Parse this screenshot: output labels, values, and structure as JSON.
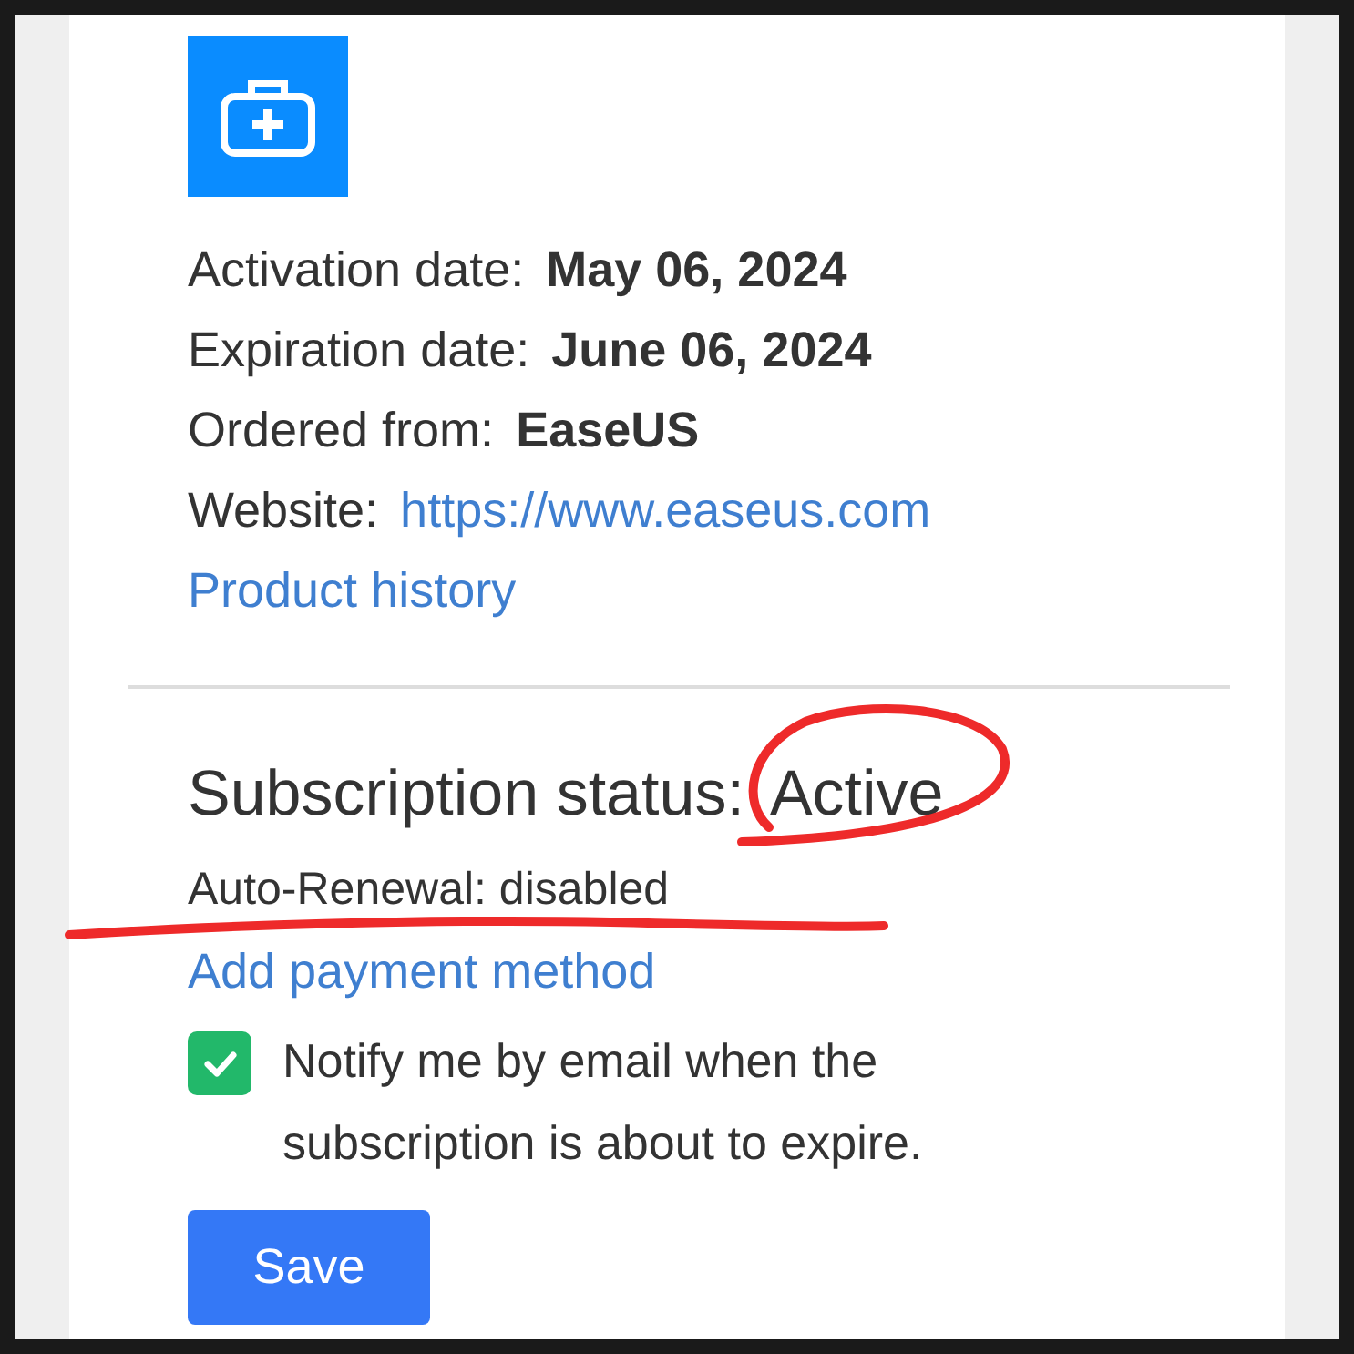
{
  "details": [
    {
      "label": "Activation date:",
      "value": "May 06, 2024",
      "kind": "bold"
    },
    {
      "label": "Expiration date:",
      "value": "June 06, 2024",
      "kind": "bold"
    },
    {
      "label": "Ordered from:",
      "value": "EaseUS",
      "kind": "bold"
    },
    {
      "label": "Website:",
      "value": "https://www.easeus.com",
      "kind": "link"
    }
  ],
  "product_history_link": "Product history",
  "subscription": {
    "label": "Subscription status:",
    "status": "Active",
    "auto_renewal": "Auto-Renewal: disabled",
    "add_payment_link": "Add payment method"
  },
  "notify": {
    "checked": true,
    "label": "Notify me by email when the subscription is about to expire."
  },
  "save_button": "Save",
  "annotations": {
    "circle": true,
    "underline": true
  }
}
